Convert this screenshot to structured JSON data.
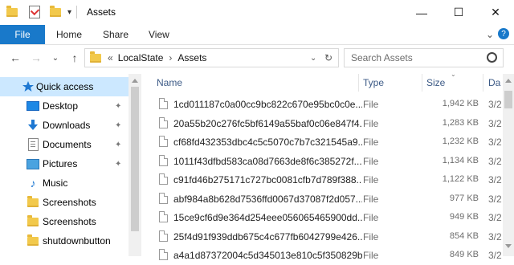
{
  "window": {
    "title": "Assets",
    "minimize_glyph": "—",
    "maximize_glyph": "☐",
    "close_glyph": "✕"
  },
  "ribbon": {
    "tabs": [
      "File",
      "Home",
      "Share",
      "View"
    ],
    "expand_glyph": "⌄",
    "help_glyph": "?"
  },
  "nav": {
    "back_glyph": "←",
    "forward_glyph": "→",
    "recent_glyph": "⌄",
    "up_glyph": "↑",
    "overflow_glyph": "«",
    "path": [
      "LocalState",
      "Assets"
    ],
    "path_sep": "›",
    "dropdown_glyph": "⌄",
    "refresh_glyph": "↻"
  },
  "search": {
    "placeholder": "Search Assets",
    "icon": "search-icon"
  },
  "sidebar": {
    "items": [
      {
        "label": "Quick access",
        "icon": "star-icon",
        "pinned": false,
        "selected": true
      },
      {
        "label": "Desktop",
        "icon": "desktop-icon",
        "pinned": true
      },
      {
        "label": "Downloads",
        "icon": "download-icon",
        "pinned": true
      },
      {
        "label": "Documents",
        "icon": "documents-icon",
        "pinned": true
      },
      {
        "label": "Pictures",
        "icon": "pictures-icon",
        "pinned": true
      },
      {
        "label": "Music",
        "icon": "music-icon",
        "pinned": false
      },
      {
        "label": "Screenshots",
        "icon": "folder-icon",
        "pinned": false
      },
      {
        "label": "Screenshots",
        "icon": "folder-icon",
        "pinned": false
      },
      {
        "label": "shutdownbutton",
        "icon": "folder-icon",
        "pinned": false
      }
    ],
    "pin_glyph": "📌"
  },
  "list": {
    "columns": {
      "name": "Name",
      "type": "Type",
      "size": "Size",
      "date": "Da"
    },
    "rows": [
      {
        "name": "1cd011187c0a00cc9bc822c670e95bc0c0e...",
        "type": "File",
        "size": "1,942 KB",
        "date": "3/2"
      },
      {
        "name": "20a55b20c276fc5bf6149a55baf0c06e847f4...",
        "type": "File",
        "size": "1,283 KB",
        "date": "3/2"
      },
      {
        "name": "cf68fd432353dbc4c5c5070c7b7c321545a9...",
        "type": "File",
        "size": "1,232 KB",
        "date": "3/2"
      },
      {
        "name": "1011f43dfbd583ca08d7663de8f6c385272f...",
        "type": "File",
        "size": "1,134 KB",
        "date": "3/2"
      },
      {
        "name": "c91fd46b275171c727bc0081cfb7d789f388...",
        "type": "File",
        "size": "1,122 KB",
        "date": "3/2"
      },
      {
        "name": "abf984a8b628d7536ffd0067d37087f2d057...",
        "type": "File",
        "size": "977 KB",
        "date": "3/2"
      },
      {
        "name": "15ce9cf6d9e364d254eee056065465900dd...",
        "type": "File",
        "size": "949 KB",
        "date": "3/2"
      },
      {
        "name": "25f4d91f939ddb675c4c677fb6042799e426...",
        "type": "File",
        "size": "854 KB",
        "date": "3/2"
      },
      {
        "name": "a4a1d87372004c5d345013e810c5f350829b...",
        "type": "File",
        "size": "849 KB",
        "date": "3/2"
      }
    ]
  },
  "colors": {
    "accent": "#1979ca",
    "selected": "#cce8ff",
    "header_text": "#3c5a86"
  }
}
